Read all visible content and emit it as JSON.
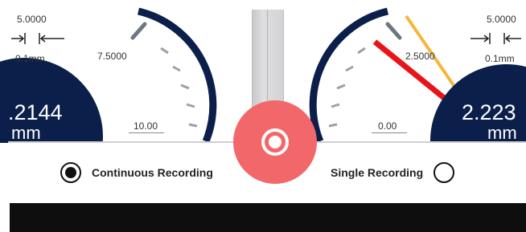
{
  "left_gauge": {
    "top_label": "5.0000",
    "resolution": "0.1mm",
    "scale_labels": [
      "7.5000",
      "10.00"
    ],
    "reading_value": ".2144",
    "reading_unit": "mm"
  },
  "right_gauge": {
    "top_label": "5.0000",
    "resolution": "0.1mm",
    "scale_labels": [
      "2.5000",
      "0.00"
    ],
    "reading_value": "2.223",
    "reading_unit": "mm"
  },
  "record_button": {
    "icon": "record-icon",
    "color": "#f2676a"
  },
  "recording_modes": {
    "continuous_label": "Continuous Recording",
    "single_label": "Single Recording",
    "selected": "continuous"
  },
  "colors": {
    "gauge_dark": "#0b1f4a",
    "needle_red": "#e8141a",
    "needle_yellow": "#f4b73a",
    "tick_gray": "#6e7780"
  }
}
